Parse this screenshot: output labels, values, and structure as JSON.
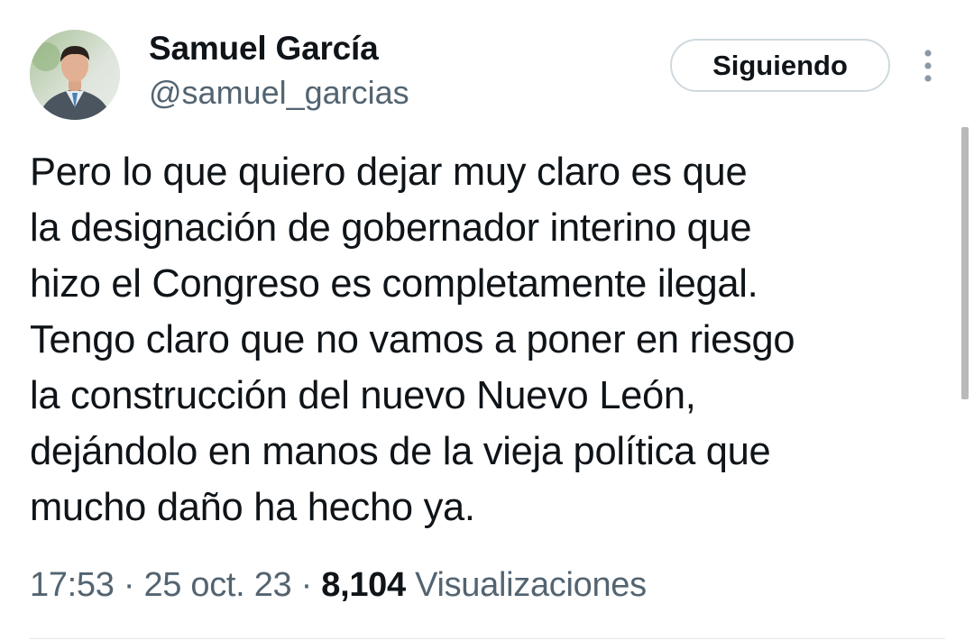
{
  "author": {
    "name": "Samuel García",
    "handle": "@samuel_garcias"
  },
  "follow_button": {
    "label": "Siguiendo"
  },
  "more_button": {
    "icon": "more-vertical-icon"
  },
  "tweet": {
    "lines": [
      "Pero lo que quiero dejar muy claro es que",
      "la designación de gobernador interino que",
      "hizo el Congreso es completamente ilegal.",
      "Tengo claro que no vamos a poner en riesgo",
      "la construcción del nuevo Nuevo León,",
      "dejándolo en manos de la vieja política que",
      "mucho daño ha hecho ya."
    ]
  },
  "meta": {
    "time": "17:53",
    "separator": " · ",
    "date": "25 oct. 23",
    "views_count": "8,104",
    "views_label": "Visualizaciones"
  },
  "colors": {
    "text_primary": "#0f1419",
    "text_secondary": "#536471",
    "button_border": "#cfd9de",
    "background": "#ffffff"
  }
}
